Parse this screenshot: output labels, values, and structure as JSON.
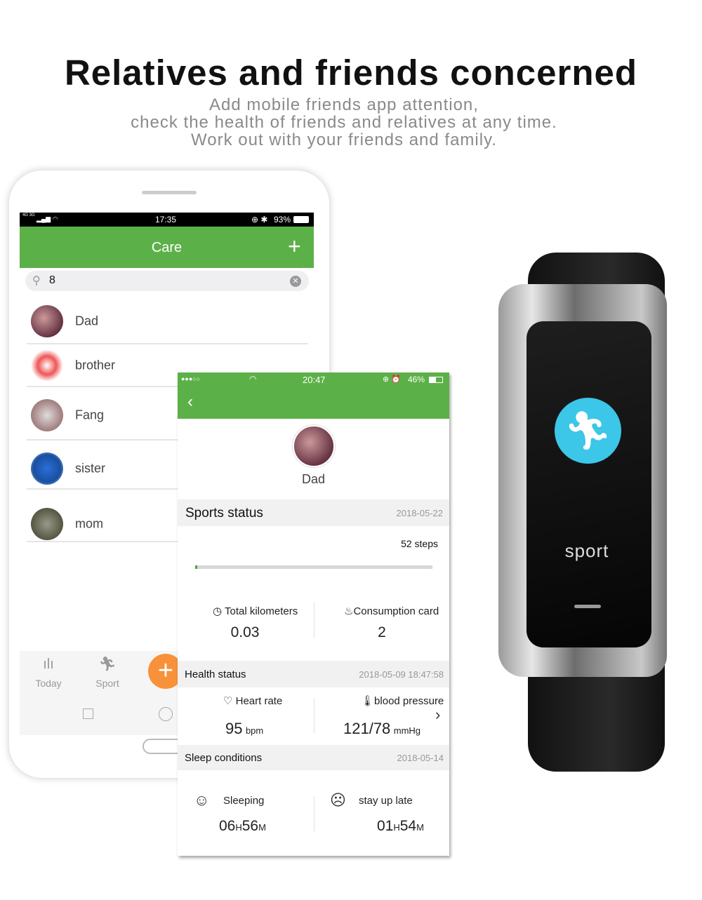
{
  "headline": {
    "title": "Relatives and friends concerned",
    "lines": [
      "Add mobile friends app attention,",
      "check the health of friends and relatives at any time.",
      "Work out with your friends and family."
    ]
  },
  "phone_back": {
    "status": {
      "signal": "4G 3G",
      "time": "17:35",
      "battery": "93%"
    },
    "header": {
      "title": "Care",
      "add_icon": "plus-icon"
    },
    "search": {
      "value": "8",
      "placeholder": ""
    },
    "contacts": [
      {
        "name": "Dad"
      },
      {
        "name": "brother"
      },
      {
        "name": "Fang"
      },
      {
        "name": "sister"
      },
      {
        "name": "mom"
      }
    ],
    "tabs": [
      {
        "label": "Today",
        "icon": "bar-chart-icon"
      },
      {
        "label": "Sport",
        "icon": "running-icon"
      }
    ],
    "accent": "#5cb048",
    "fab_color": "#f7913a"
  },
  "phone_front": {
    "status": {
      "time": "20:47",
      "battery": "46%"
    },
    "profile": {
      "name": "Dad"
    },
    "sports": {
      "title": "Sports status",
      "date": "2018-05-22",
      "steps": "52 steps",
      "progress_percent": 1,
      "km_label": "Total kilometers",
      "km": "0.03",
      "cal_label": "Consumption card",
      "cal": "2"
    },
    "health": {
      "title": "Health status",
      "date": "2018-05-09 18:47:58",
      "hr_label": "Heart rate",
      "hr": "95",
      "hr_unit": "bpm",
      "bp_label": "blood pressure",
      "bp": "121/78",
      "bp_unit": "mmHg"
    },
    "sleep": {
      "title": "Sleep conditions",
      "date": "2018-05-14",
      "sleep_label": "Sleeping",
      "sleep_h": "06",
      "sleep_m": "56",
      "late_label": "stay up late",
      "late_h": "01",
      "late_m": "54",
      "h": "H",
      "m": "M"
    }
  },
  "watch": {
    "label": "sport",
    "icon": "running-icon",
    "icon_color": "#3cc6e8"
  }
}
